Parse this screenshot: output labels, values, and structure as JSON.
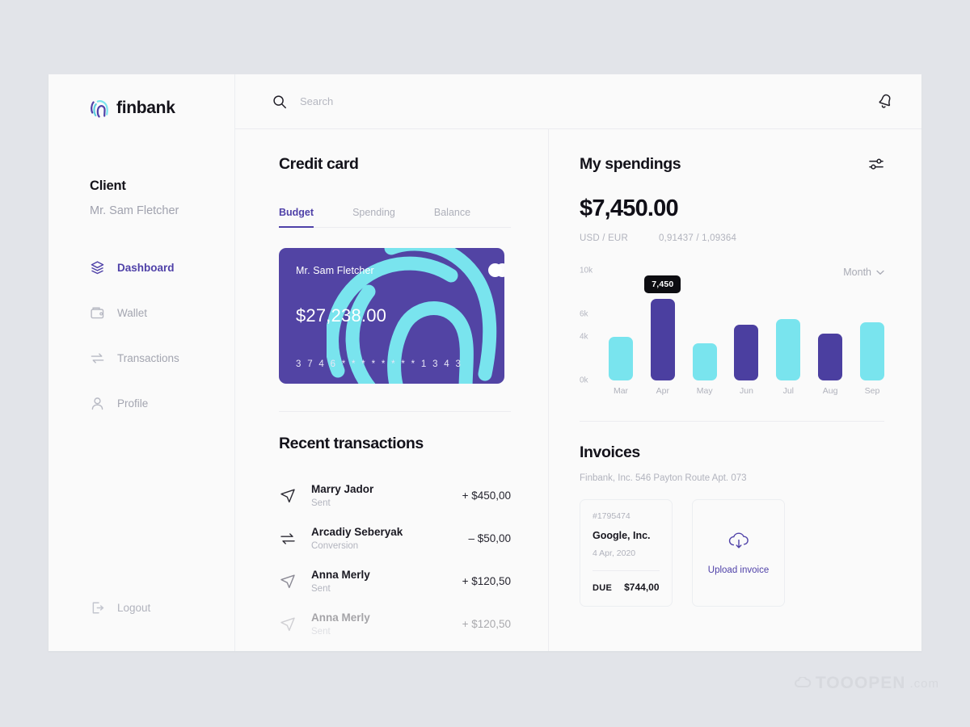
{
  "brand": {
    "name": "finbank",
    "logo_icon": "fingerprint-icon",
    "purple": "#4f41a8",
    "cyan": "#79e4ee"
  },
  "sidebar": {
    "client_label": "Client",
    "client_name": "Mr. Sam Fletcher",
    "items": [
      {
        "label": "Dashboard",
        "icon": "layers-icon",
        "active": true
      },
      {
        "label": "Wallet",
        "icon": "wallet-icon",
        "active": false
      },
      {
        "label": "Transactions",
        "icon": "exchange-icon",
        "active": false
      },
      {
        "label": "Profile",
        "icon": "user-icon",
        "active": false
      }
    ],
    "logout": {
      "label": "Logout",
      "icon": "logout-icon"
    }
  },
  "topbar": {
    "search": {
      "placeholder": "Search",
      "value": "",
      "icon": "search-icon"
    },
    "notification_icon": "bell-icon"
  },
  "credit_card_panel": {
    "title": "Credit card",
    "tabs": [
      {
        "label": "Budget",
        "active": true
      },
      {
        "label": "Spending",
        "active": false
      },
      {
        "label": "Balance",
        "active": false
      }
    ],
    "card": {
      "holder": "Mr. Sam Fletcher",
      "amount": "$27,238.00",
      "number": "3 7 4 6   * * * *   * * * *   1 3 4 3",
      "brand_icon": "mastercard-icon",
      "bg_color": "#5244a4",
      "art_color": "#79e4ee"
    }
  },
  "transactions_panel": {
    "title": "Recent transactions",
    "rows": [
      {
        "name": "Marry Jador",
        "type": "Sent",
        "amount": "+ $450,00",
        "icon": "send-icon",
        "faded": false
      },
      {
        "name": "Arcadiy Seberyak",
        "type": "Conversion",
        "amount": "– $50,00",
        "icon": "exchange-icon",
        "faded": false
      },
      {
        "name": "Anna Merly",
        "type": "Sent",
        "amount": "+ $120,50",
        "icon": "send-icon",
        "faded": false
      },
      {
        "name": "Anna Merly",
        "type": "Sent",
        "amount": "+ $120,50",
        "icon": "send-icon",
        "faded": true
      }
    ]
  },
  "spendings_panel": {
    "title": "My spendings",
    "filter_icon": "sliders-icon",
    "amount": "$7,450.00",
    "rate_pair_label": "USD / EUR",
    "rate_pair_value": "0,91437 / 1,09364",
    "period_selector": {
      "label": "Month",
      "icon": "chevron-down-icon"
    }
  },
  "chart_data": {
    "type": "bar",
    "title": "My spendings",
    "xlabel": "",
    "ylabel": "",
    "ylim": [
      0,
      10000
    ],
    "yticks": [
      0,
      4000,
      6000,
      10000
    ],
    "ytick_labels": [
      "0k",
      "4k",
      "6k",
      "10k"
    ],
    "grid": false,
    "legend": "none",
    "categories": [
      "Mar",
      "Apr",
      "May",
      "Jun",
      "Jul",
      "Aug",
      "Sep"
    ],
    "values": [
      3950,
      7450,
      3350,
      5100,
      5600,
      4300,
      5300
    ],
    "colors": [
      "#79e4ee",
      "#4b3fa0",
      "#79e4ee",
      "#4b3fa0",
      "#79e4ee",
      "#4b3fa0",
      "#79e4ee"
    ],
    "annotations": [
      {
        "category": "Apr",
        "label": "7,450",
        "value": 7450
      }
    ],
    "highlighted_category": "Apr",
    "period": "Month"
  },
  "invoices_panel": {
    "title": "Invoices",
    "address": "Finbank, Inc. 546 Payton Route Apt. 073",
    "invoice": {
      "number": "#1795474",
      "company": "Google, Inc.",
      "date": "4 Apr, 2020",
      "due_label": "DUE",
      "due_amount": "$744,00"
    },
    "upload": {
      "label": "Upload invoice",
      "icon": "cloud-download-icon"
    }
  },
  "watermark": {
    "main": "TOOOPEN",
    "sub": ".com"
  }
}
